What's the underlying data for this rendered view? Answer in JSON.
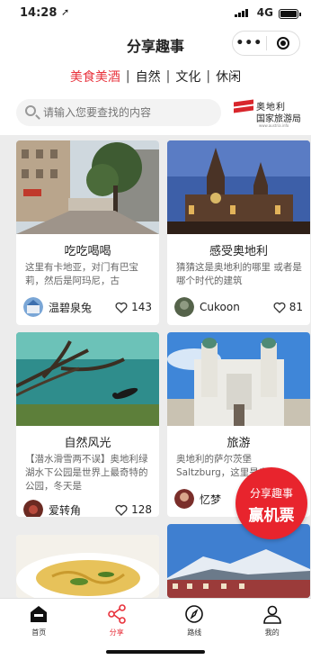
{
  "status": {
    "time": "14:28",
    "network": "4G"
  },
  "nav": {
    "title": "分享趣事"
  },
  "categories": {
    "items": [
      "美食美酒",
      "自然",
      "文化",
      "休闲"
    ],
    "separator": "|",
    "active_index": 0
  },
  "search": {
    "placeholder": "请输入您要查找的内容"
  },
  "logo": {
    "line1": "奥地利",
    "line2": "国家旅游局",
    "url": "www.austria.info"
  },
  "cards": [
    {
      "title": "吃吃喝喝",
      "desc": "这里有卡地亚，对门有巴宝莉，然后是阿玛尼，古",
      "author": "温碧泉兔",
      "likes": "143"
    },
    {
      "title": "感受奥地利",
      "desc": "猜猜这是奥地利的哪里 或者是哪个时代的建筑",
      "author": "Cukoon",
      "likes": "81"
    },
    {
      "title": "自然风光",
      "desc": "【潜水滑雪两不误】奥地利绿湖水下公园是世界上最奇特的公园，冬天是",
      "author": "爱转角",
      "likes": "128"
    },
    {
      "title": "旅游",
      "desc": "奥地利的萨尔茨堡 Saltzburg，这里是奥",
      "author": "忆梦",
      "likes": ""
    }
  ],
  "promo": {
    "line1": "分享趣事",
    "line2": "赢机票"
  },
  "tabs": [
    {
      "label": "首页",
      "icon": "home-icon"
    },
    {
      "label": "分享",
      "icon": "share-icon"
    },
    {
      "label": "路线",
      "icon": "compass-icon"
    },
    {
      "label": "我的",
      "icon": "user-icon"
    }
  ],
  "colors": {
    "accent": "#e8323c",
    "promo": "#e8242d"
  }
}
